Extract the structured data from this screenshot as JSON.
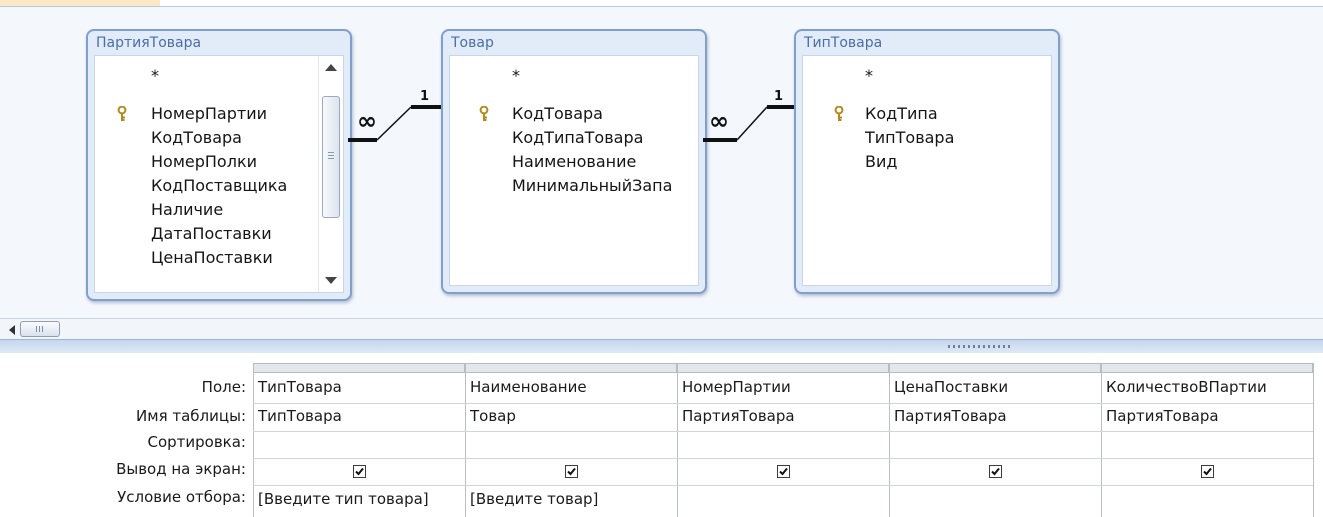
{
  "diagram": {
    "tables": [
      {
        "title": "ПартияТовара",
        "fields": [
          {
            "name": "*",
            "key": false
          },
          {
            "name": "НомерПартии",
            "key": true
          },
          {
            "name": "КодТовара",
            "key": false
          },
          {
            "name": "НомерПолки",
            "key": false
          },
          {
            "name": "КодПоставщика",
            "key": false
          },
          {
            "name": "Наличие",
            "key": false
          },
          {
            "name": "ДатаПоставки",
            "key": false
          },
          {
            "name": "ЦенаПоставки",
            "key": false
          }
        ]
      },
      {
        "title": "Товар",
        "fields": [
          {
            "name": "*",
            "key": false
          },
          {
            "name": "КодТовара",
            "key": true
          },
          {
            "name": "КодТипаТовара",
            "key": false
          },
          {
            "name": "Наименование",
            "key": false
          },
          {
            "name": "МинимальныйЗапа",
            "key": false
          }
        ]
      },
      {
        "title": "ТипТовара",
        "fields": [
          {
            "name": "*",
            "key": false
          },
          {
            "name": "КодТипа",
            "key": true
          },
          {
            "name": "ТипТовара",
            "key": false
          },
          {
            "name": "Вид",
            "key": false
          }
        ]
      }
    ],
    "relationships": [
      {
        "many_label": "∞",
        "one_label": "1"
      },
      {
        "many_label": "∞",
        "one_label": "1"
      }
    ]
  },
  "grid": {
    "row_labels": [
      "Поле:",
      "Имя таблицы:",
      "Сортировка:",
      "Вывод на экран:",
      "Условие отбора:"
    ],
    "columns": [
      {
        "field": "ТипТовара",
        "table": "ТипТовара",
        "sort": "",
        "show": true,
        "criteria": "[Введите тип товара]"
      },
      {
        "field": "Наименование",
        "table": "Товар",
        "sort": "",
        "show": true,
        "criteria": "[Введите товар]"
      },
      {
        "field": "НомерПартии",
        "table": "ПартияТовара",
        "sort": "",
        "show": true,
        "criteria": ""
      },
      {
        "field": "ЦенаПоставки",
        "table": "ПартияТовара",
        "sort": "",
        "show": true,
        "criteria": ""
      },
      {
        "field": "КоличествоВПартии",
        "table": "ПартияТовара",
        "sort": "",
        "show": true,
        "criteria": ""
      }
    ]
  },
  "colors": {
    "table_border": "#7f9fcf",
    "table_title": "#4a6ea8",
    "pane_background": "#f4f8fd",
    "splitter": "#c5d6ed"
  },
  "icons": {
    "primary_key": "key-icon",
    "checkbox": "checkmark-icon"
  }
}
